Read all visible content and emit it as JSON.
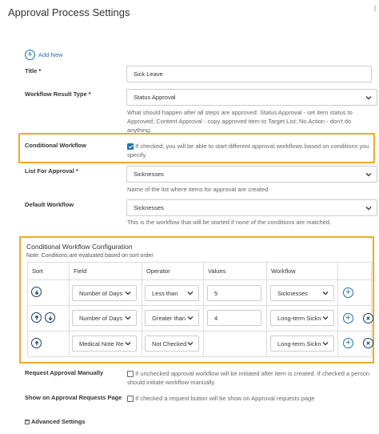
{
  "page": {
    "title": "Approval Process Settings",
    "corner_mark": "|"
  },
  "add_new": {
    "label": "Add New",
    "icon": "plus-circle-icon"
  },
  "title_field": {
    "label": "Title *",
    "value": "Sick Leave"
  },
  "workflow_result": {
    "label": "Workflow Result Type *",
    "value": "Status Approval",
    "help": "What should happen after all steps are approved: Status Approval - set item status to Approved; Content Approval - copy approved item to Target List; No Action - don't do anything."
  },
  "conditional_workflow": {
    "label": "Conditional Workflow",
    "checked": true,
    "help": "If checked, you will be able to start different approval workflows based on conditions you specify"
  },
  "list_for_approval": {
    "label": "List For Approval *",
    "value": "Sicknesses",
    "help": "Name of the list where items for approval are created"
  },
  "default_workflow": {
    "label": "Default Workflow",
    "value": "Sicknesses",
    "help": "This is the workflow that will be started if none of the conditions are matched."
  },
  "config": {
    "title": "Conditional Workflow Configuration",
    "note": "Note: Conditions are evaluated based on sort order",
    "headers": {
      "sort": "Sort",
      "field": "Field",
      "operator": "Operator",
      "values": "Values",
      "workflow": "Workflow"
    },
    "rows": [
      {
        "field": "Number of Days",
        "operator": "Less than",
        "value": "5",
        "workflow": "Sicknesses"
      },
      {
        "field": "Number of Days",
        "operator": "Greater than",
        "value": "4",
        "workflow": "Long-term Sickness"
      },
      {
        "field": "Medical Note Required",
        "operator": "Not Checked",
        "value": "",
        "workflow": "Long-term Sickness"
      }
    ]
  },
  "request_manually": {
    "label": "Request Approval Manually",
    "checked": false,
    "help": "If unchecked approval workflow will be initiated after item is created. If checked a person should initiate workflow manually"
  },
  "show_on_requests": {
    "label": "Show on Approval Requests Page",
    "checked": false,
    "help": "If checked a request button will be show on Approval requests page"
  },
  "advanced": {
    "label": "Advanced Settings",
    "icon": "expand-plus-icon"
  }
}
